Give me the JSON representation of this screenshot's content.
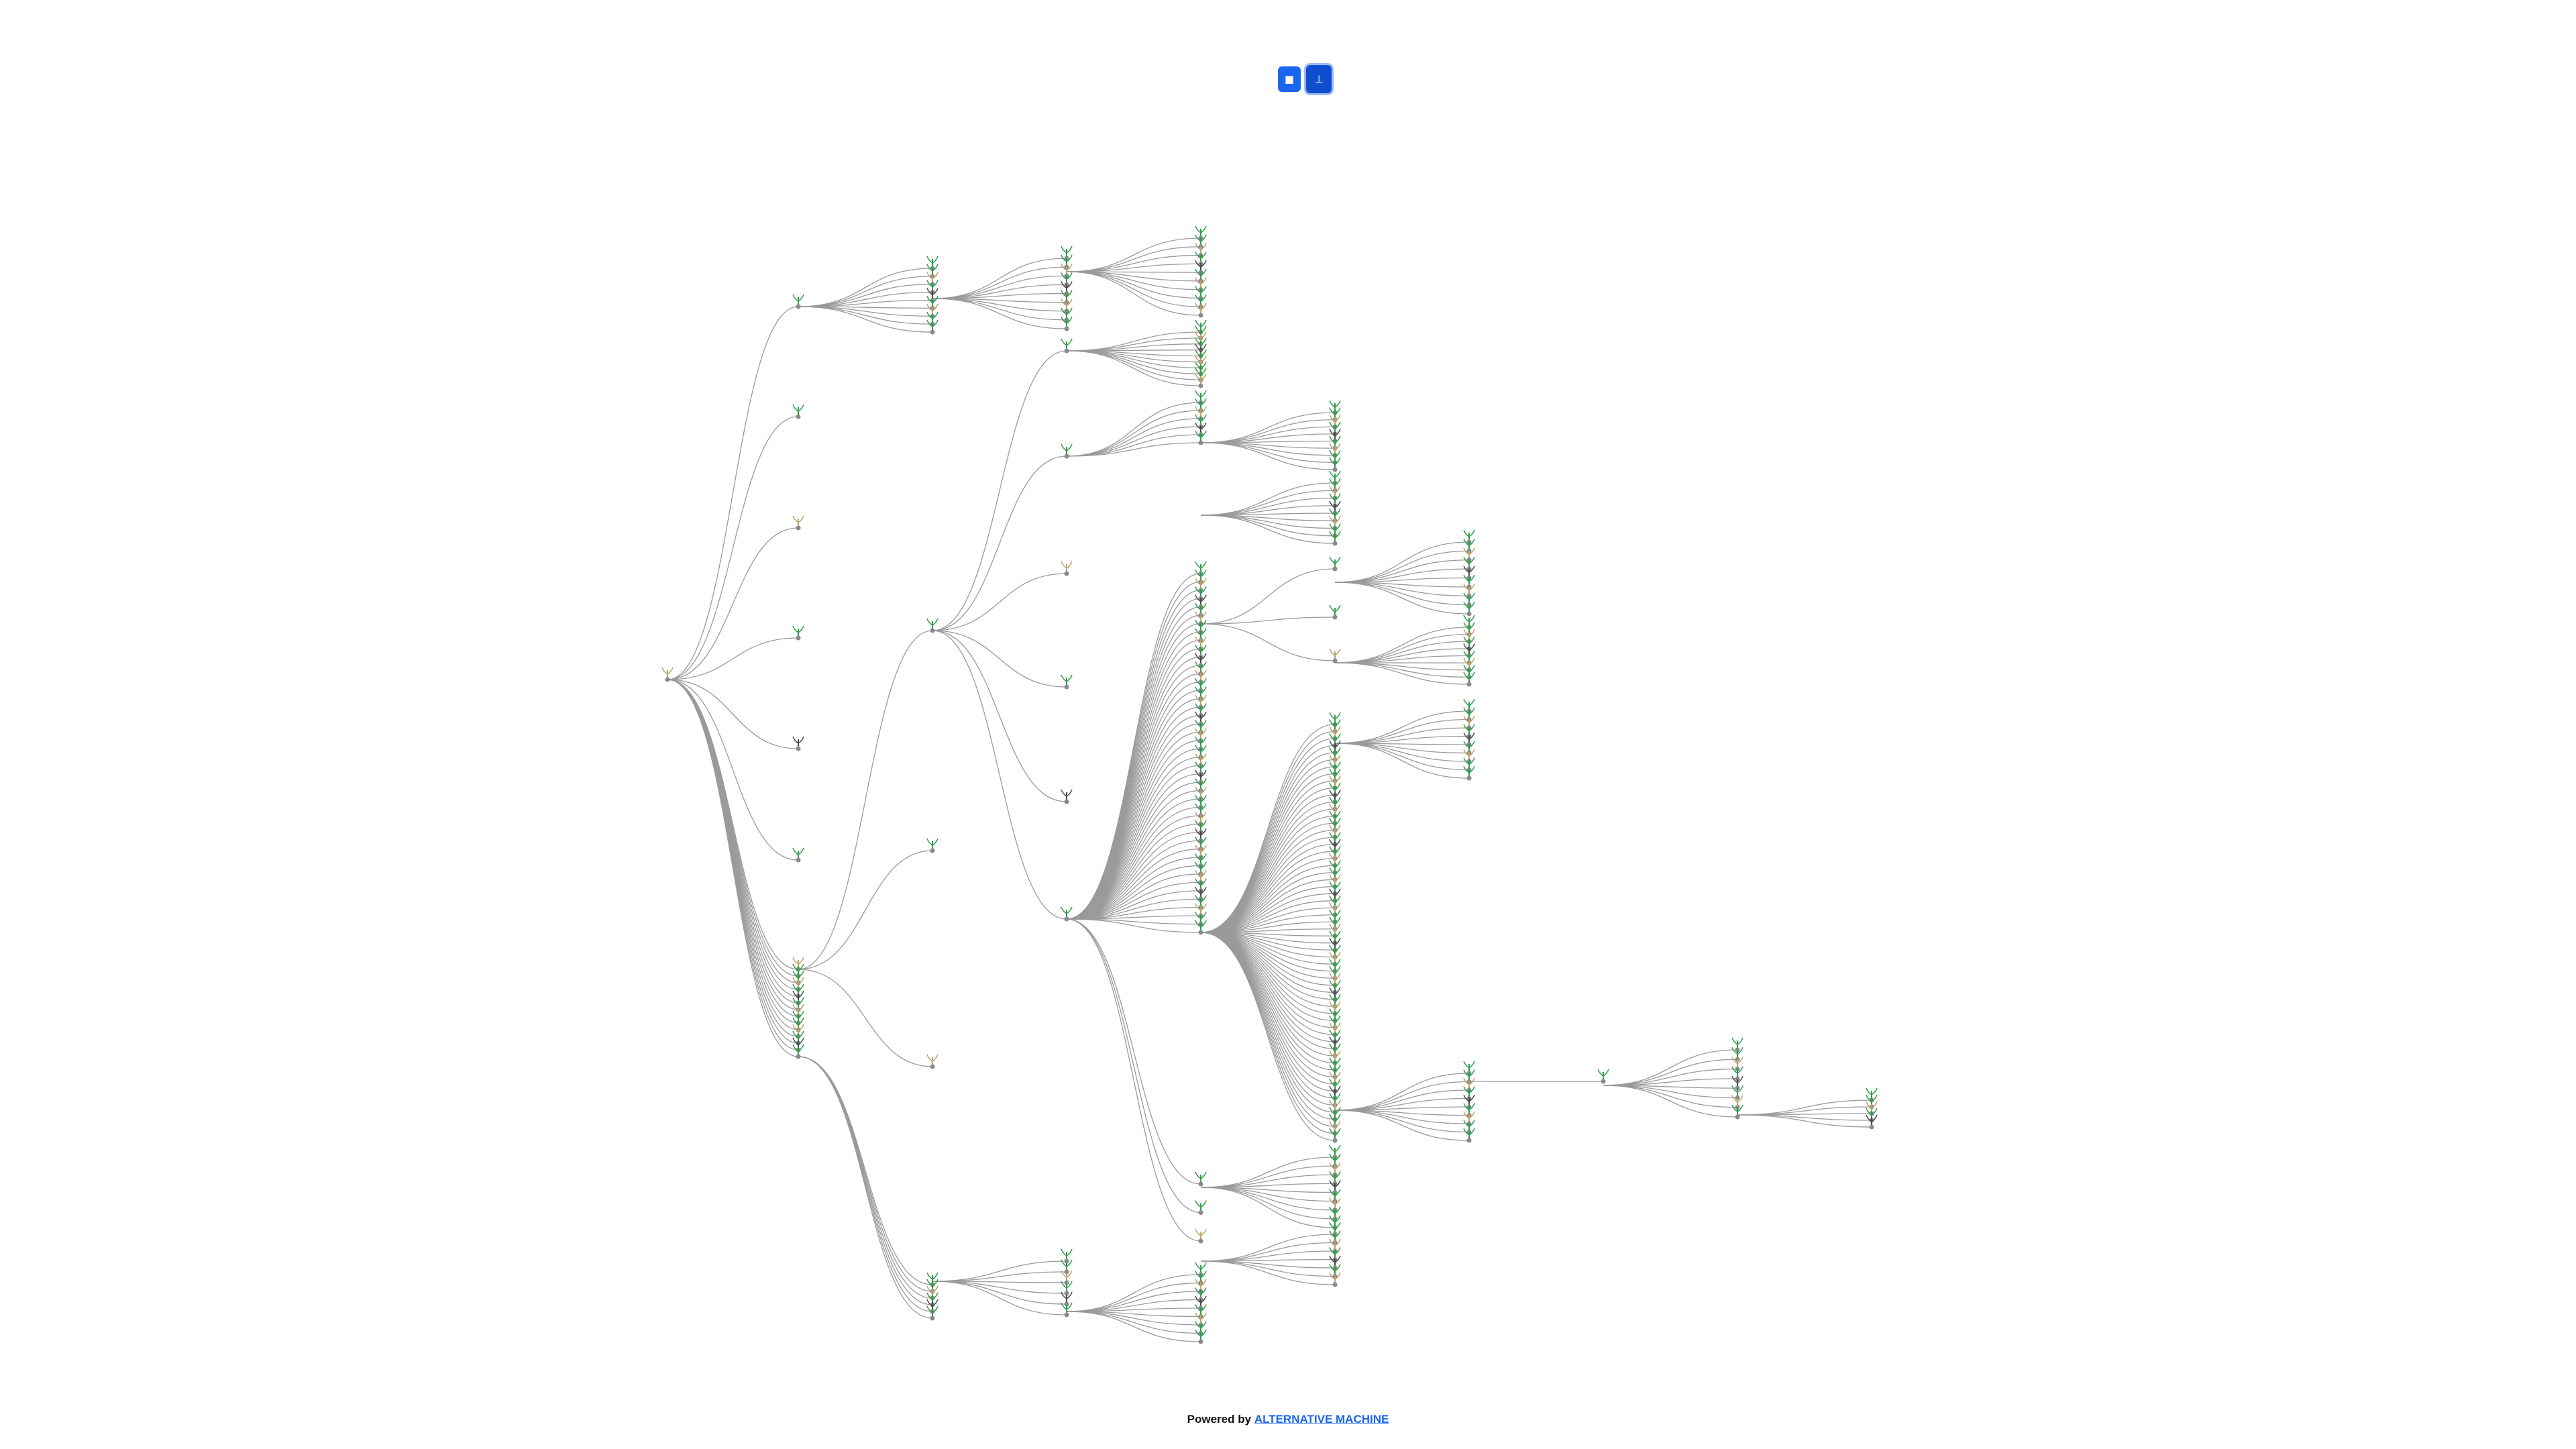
{
  "toolbar": {
    "buttons": [
      {
        "icon": "square-icon",
        "glyph": "■"
      },
      {
        "icon": "download-icon",
        "glyph": "⊥"
      }
    ]
  },
  "footer": {
    "prefix": "Powered by",
    "link_text": "ALTERNATIVE MACHINE"
  },
  "colors": {
    "accent": "#1a66ee",
    "edge": "#9a9a9a",
    "node_green": "#2e9e4a",
    "node_dark": "#4a4a4a",
    "node_tan": "#b9a56a"
  }
}
